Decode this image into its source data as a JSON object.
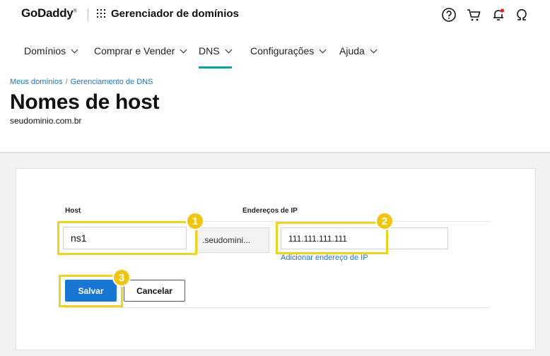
{
  "header": {
    "logo": "GoDaddy",
    "app_title": "Gerenciador de domínios",
    "icons": [
      "help-icon",
      "cart-icon",
      "bell-icon",
      "user-icon"
    ],
    "notification_dot_color": "#e02020"
  },
  "nav": {
    "items": [
      {
        "label": "Domínios"
      },
      {
        "label": "Comprar e Vender"
      },
      {
        "label": "DNS",
        "active": true
      },
      {
        "label": "Configurações"
      },
      {
        "label": "Ajuda"
      }
    ],
    "active_color": "#00a4a6"
  },
  "breadcrumb": {
    "items": [
      "Meus domínios",
      "Gerenciamento de DNS"
    ]
  },
  "page": {
    "title": "Nomes de host",
    "domain": "seudominio.com.br"
  },
  "form": {
    "host_label": "Host",
    "ip_label": "Endereços de IP",
    "host_value": "ns1",
    "domain_suffix": ".seudomini...",
    "ip_value": "111.111.111.111",
    "add_ip_link": "Adicionar endereço de IP",
    "save_label": "Salvar",
    "cancel_label": "Cancelar"
  },
  "annotations": {
    "badges": [
      "1",
      "2",
      "3"
    ],
    "highlight_color": "#efd323"
  }
}
